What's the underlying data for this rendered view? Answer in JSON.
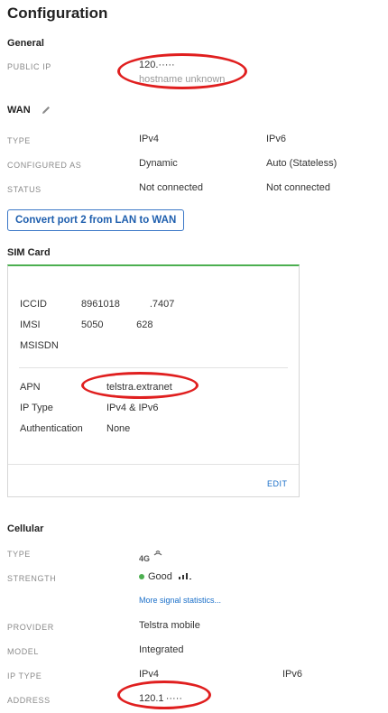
{
  "page": {
    "title": "Configuration"
  },
  "general": {
    "title": "General",
    "public_ip_label": "PUBLIC IP",
    "public_ip_value": "120.⁠⁠·····",
    "hostname": "hostname unknown"
  },
  "wan": {
    "title": "WAN",
    "edit_icon": "pencil-icon",
    "rows": [
      {
        "label": "TYPE",
        "ipv4": "IPv4",
        "ipv6": "IPv6"
      },
      {
        "label": "CONFIGURED AS",
        "ipv4": "Dynamic",
        "ipv6": "Auto (Stateless)"
      },
      {
        "label": "STATUS",
        "ipv4": "Not connected",
        "ipv6": "Not connected"
      }
    ],
    "convert_button": "Convert port 2 from LAN to WAN"
  },
  "sim": {
    "title": "SIM Card",
    "iccid_label": "ICCID",
    "iccid_value": "8961018         .7407",
    "imsi_label": "IMSI",
    "imsi_value": "5050          628",
    "msisdn_label": "MSISDN",
    "msisdn_value": "",
    "apn_label": "APN",
    "apn_value": "telstra.extranet",
    "iptype_label": "IP Type",
    "iptype_value": "IPv4 & IPv6",
    "auth_label": "Authentication",
    "auth_value": "None",
    "edit_label": "EDIT"
  },
  "cellular": {
    "title": "Cellular",
    "type_label": "TYPE",
    "type_value": "4G",
    "strength_label": "STRENGTH",
    "strength_value": "Good",
    "more_stats": "More signal statistics...",
    "provider_label": "PROVIDER",
    "provider_value": "Telstra mobile",
    "model_label": "MODEL",
    "model_value": "Integrated",
    "iptype_label": "IP TYPE",
    "iptype_ipv4": "IPv4",
    "iptype_ipv6": "IPv6",
    "address_label": "ADDRESS",
    "address_value": "120.1 ·····"
  },
  "colors": {
    "accent": "#1f5fae",
    "good": "#4caf50",
    "annotation": "#e01f1f"
  }
}
